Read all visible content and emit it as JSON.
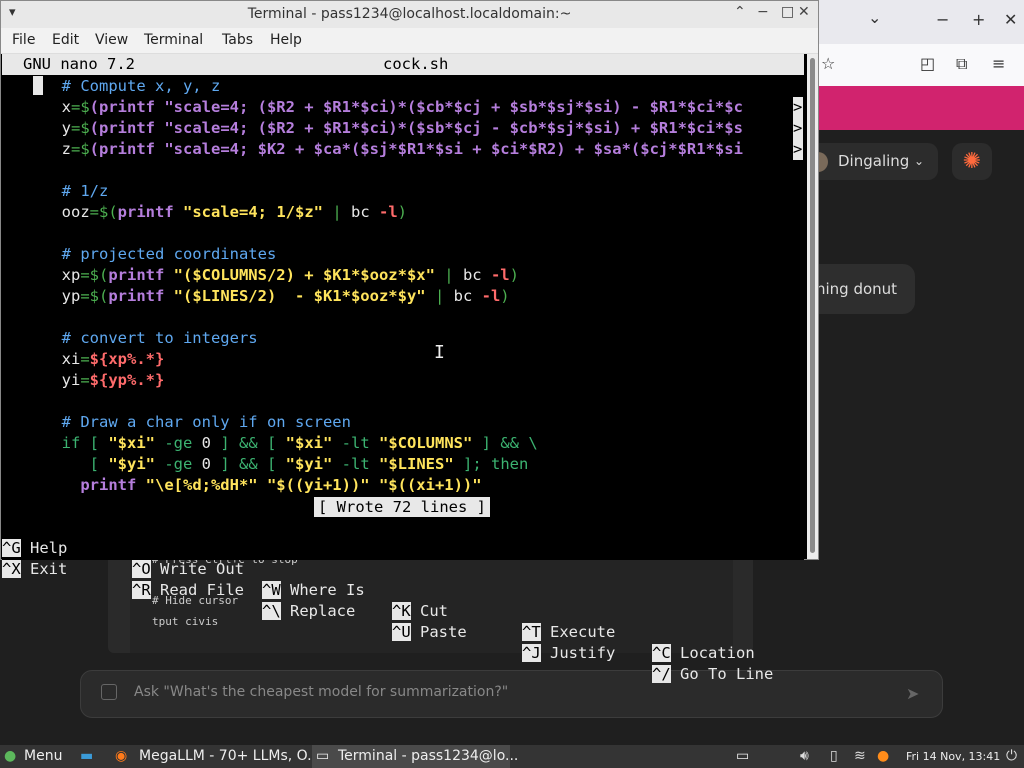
{
  "browser": {
    "tab_chevron": "⌄",
    "window_controls": [
      "−",
      "+",
      "✕"
    ],
    "toolbar_icons": [
      "☆",
      "◰",
      "⧉",
      "≡"
    ],
    "account": {
      "name": "Dingaling",
      "chevron": "⌄"
    },
    "star_icon": "✺",
    "message_partial": "ning donut",
    "code_lines": [
      "# Press Ctrl+C to stop",
      "# Hide cursor",
      "tput civis"
    ],
    "prompt_placeholder": "Ask \"What's the cheapest model for summarization?\""
  },
  "terminal": {
    "title": "Terminal - pass1234@localhost.localdomain:~",
    "menu": [
      "File",
      "Edit",
      "View",
      "Terminal",
      "Tabs",
      "Help"
    ],
    "win_buttons": [
      "⌃",
      "−",
      "✕"
    ]
  },
  "nano": {
    "version": "GNU nano 7.2",
    "filename": "cock.sh",
    "status": "[ Wrote 72 lines ]",
    "lines": {
      "c1": "  # Compute x, y, z",
      "x_head": "  x",
      "x_body": "(printf \"scale=4; ($R2 + $R1*$ci)*($cb*$cj + $sb*$sj*$si) - $R1*$ci*$c",
      "y_head": "  y",
      "y_body": "(printf \"scale=4; ($R2 + $R1*$ci)*($sb*$cj - $cb*$sj*$si) + $R1*$ci*$s",
      "z_head": "  z",
      "z_body": "(printf \"scale=4; $K2 + $ca*($sj*$R1*$si + $ci*$R2) + $sa*($cj*$R1*$si",
      "c2": "  # 1/z",
      "ooz_head": "  ooz",
      "ooz_str": "\"scale=4; 1/$z\"",
      "c3": "  # projected coordinates",
      "xp_head": "  xp",
      "xp_str": "\"($COLUMNS/2) + $K1*$ooz*$x\"",
      "yp_head": "  yp",
      "yp_str": "\"($LINES/2)  - $K1*$ooz*$y\"",
      "c4": "  # convert to integers",
      "xi_head": "  xi",
      "xi_val": "${xp%.*}",
      "yi_head": "  yi",
      "yi_val": "${yp%.*}",
      "c5": "  # Draw a char only if on screen",
      "printf_line": "\"\\e[%d;%dH*\" \"$((yi+1))\" \"$((xi+1))\""
    },
    "shortcuts": [
      {
        "key": "^G",
        "label": "Help"
      },
      {
        "key": "^O",
        "label": "Write Out"
      },
      {
        "key": "^W",
        "label": "Where Is"
      },
      {
        "key": "^K",
        "label": "Cut"
      },
      {
        "key": "^T",
        "label": "Execute"
      },
      {
        "key": "^C",
        "label": "Location"
      },
      {
        "key": "^X",
        "label": "Exit"
      },
      {
        "key": "^R",
        "label": "Read File"
      },
      {
        "key": "^\\",
        "label": "Replace"
      },
      {
        "key": "^U",
        "label": "Paste"
      },
      {
        "key": "^J",
        "label": "Justify"
      },
      {
        "key": "^/",
        "label": "Go To Line"
      }
    ]
  },
  "taskbar": {
    "menu_label": "Menu",
    "tasks": [
      "MegaLLM - 70+ LLMs, O...",
      "Terminal - pass1234@lo..."
    ],
    "clock": "Fri 14 Nov, 13:41",
    "tray_icons": [
      "speaker-icon",
      "battery-icon",
      "wifi-icon",
      "update-icon"
    ]
  }
}
